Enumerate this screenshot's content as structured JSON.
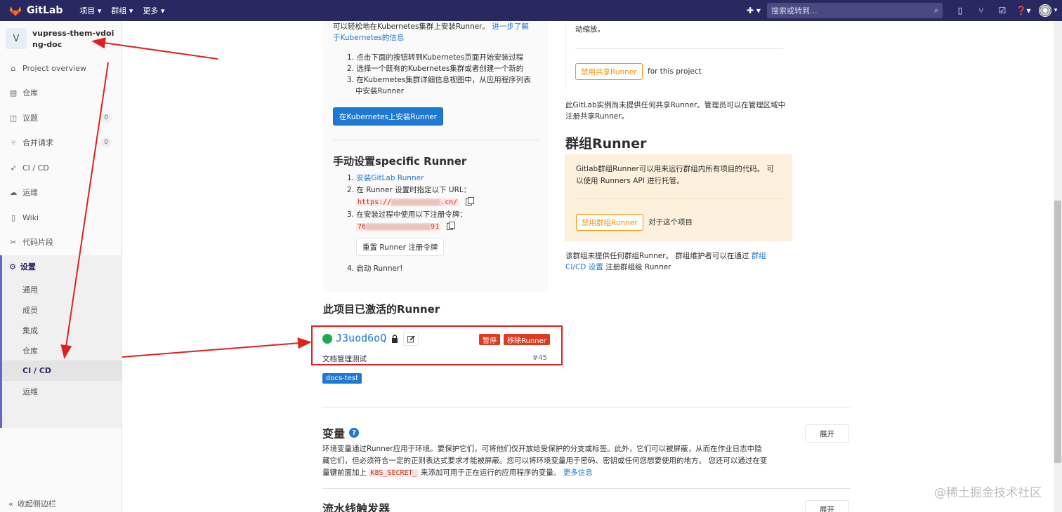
{
  "navbar": {
    "brand": "GitLab",
    "menu": [
      "项目 ▾",
      "群组 ▾",
      "更多 ▾"
    ],
    "plus": "✚ ▾",
    "search_placeholder": "搜索或转到..."
  },
  "sidebar": {
    "project_initial": "V",
    "project_name": "vupress-them-vdoing-doc",
    "items": [
      {
        "label": "Project overview",
        "icon": "home-icon"
      },
      {
        "label": "仓库",
        "icon": "doc-icon"
      },
      {
        "label": "议题",
        "icon": "issues-icon",
        "badge": "0"
      },
      {
        "label": "合并请求",
        "icon": "merge-request-icon",
        "badge": "0"
      },
      {
        "label": "CI / CD",
        "icon": "rocket-icon"
      },
      {
        "label": "运维",
        "icon": "cloud-icon"
      },
      {
        "label": "Wiki",
        "icon": "book-icon"
      },
      {
        "label": "代码片段",
        "icon": "scissors-icon"
      }
    ],
    "settings_label": "设置",
    "settings_sub": [
      "通用",
      "成员",
      "集成",
      "仓库",
      "CI / CD",
      "运维"
    ],
    "active_sub": "CI / CD",
    "collapse_label": "收起侧边栏"
  },
  "left_panel": {
    "intro_line1": "可以轻松地在Kubernetes集群上安装Runner。",
    "intro_link_a": "进一步了解",
    "intro_link_b": "于Kubernetes的信息",
    "steps": [
      "1. 点击下面的按钮转到Kubernetes页面开始安装过程",
      "2. 选择一个既有的Kubernetes集群或者创建一个新的",
      "3. 在Kubernetes集群详细信息视图中，从应用程序列表",
      "中安装Runner"
    ],
    "install_button": "在Kubernetes上安装Runner",
    "manual_title": "手动设置specific Runner",
    "manual_step1_prefix": "1. ",
    "manual_step1_link": "安装GitLab Runner",
    "manual_step2": "2. 在 Runner 设置时指定以下 URL：",
    "url_start": "https://",
    "url_end": ".cn/",
    "manual_step3": "3. 在安装过程中使用以下注册令牌：",
    "token_start": "76",
    "token_end": "91",
    "reset_button": "重置 Runner 注册令牌",
    "manual_step4": "4. 启动 Runner!"
  },
  "active_runners": {
    "title": "此项目已激活的Runner",
    "runner_id": "J3uod6oQ",
    "pause_button": "暂停",
    "remove_button": "移除Runner",
    "description": "文档管理测试",
    "number": "#45",
    "tag": "docs-test"
  },
  "right_panel": {
    "top_text": "动缩放。",
    "disable_shared_button": "禁用共享Runner",
    "for_project": "for this project",
    "shared_note_1": "此GitLab实例尚未提供任何共享Runner。管理员可以在管理区域中",
    "shared_note_2": "注册共享Runner。",
    "group_title": "群组Runner",
    "group_desc_1": "Gitlab群组Runner可以用来运行群组内所有项目的代码。 可",
    "group_desc_2": "以使用 Runners API 进行托管。",
    "disable_group_button": "禁用群组Runner",
    "for_this_project": "对于这个项目",
    "group_note_1": "该群组未提供任何群组Runner。 群组维护者可以在通过",
    "group_note_link_1": "群组",
    "group_note_link_2": "CI/CD 设置",
    "group_note_2": "注册群组级 Runner"
  },
  "variables": {
    "title": "变量",
    "expand_button": "展开",
    "desc_1": "环境变量通过Runner应用于环境。要保护它们，可将他们仅开放给受保护的分支或标签。此外，它们可以被屏蔽，从而在作业日志中隐",
    "desc_2": "藏它们，但必须符合一定的正则表达式要求才能被屏蔽。您可以将环境变量用于密码、密钥或任何您想要使用的地方。 您还可以通过在变",
    "desc_3a": "量键前面加上",
    "desc_code": "K8S_SECRET_",
    "desc_3b": "来添加可用于正在运行的应用程序的变量。",
    "more_link": "更多信息"
  },
  "pipeline": {
    "title": "流水线触发器",
    "expand_button": "展开"
  },
  "watermark": "@稀土掘金技术社区",
  "colors": {
    "navbar": "#292961",
    "accent": "#1f78d1",
    "danger": "#db3b21",
    "warning": "#fc9403",
    "success": "#1aaa55"
  }
}
